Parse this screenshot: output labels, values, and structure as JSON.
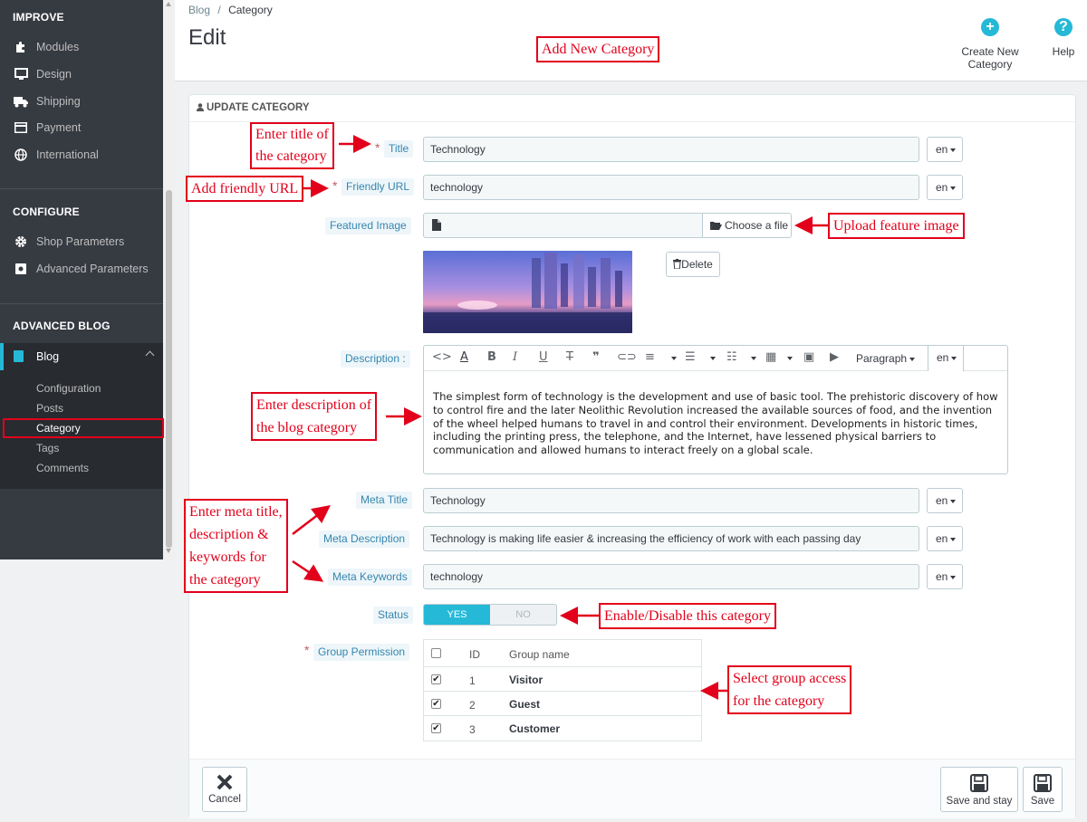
{
  "sidebar": {
    "sections": {
      "improve": "IMPROVE",
      "configure": "CONFIGURE",
      "advanced_blog": "ADVANCED BLOG"
    },
    "improve_items": [
      "Modules",
      "Design",
      "Shipping",
      "Payment",
      "International"
    ],
    "configure_items": [
      "Shop Parameters",
      "Advanced Parameters"
    ],
    "blog": "Blog",
    "blog_sub": [
      "Configuration",
      "Posts",
      "Category",
      "Tags",
      "Comments"
    ],
    "accent_color": "#25b9d7"
  },
  "header": {
    "breadcrumb": [
      "Blog",
      "/",
      "Category"
    ],
    "title": "Edit",
    "create_label": "Create New Category",
    "help_label": "Help"
  },
  "form": {
    "card_title": "UPDATE CATEGORY",
    "fields": {
      "title_label": "Title",
      "title_value": "Technology",
      "friendly_url_label": "Friendly URL",
      "friendly_url_value": "technology",
      "featured_image_label": "Featured Image",
      "choose_file": "Choose a file",
      "delete": "Delete",
      "description_label": "Description :",
      "description_text": "The simplest form of technology is the development and use of basic tool. The prehistoric discovery of how to control fire and the later Neolithic Revolution increased the available sources of food, and the invention of the wheel helped humans to travel in and control their environment. Developments in historic times, including the printing press, the telephone, and the Internet, have lessened physical barriers to communication and allowed humans to interact freely on a global scale.",
      "paragraph": "Paragraph",
      "meta_title_label": "Meta Title",
      "meta_title_value": "Technology",
      "meta_description_label": "Meta Description",
      "meta_description_value": "Technology is making life easier & increasing the efficiency of work with each passing day",
      "meta_keywords_label": "Meta Keywords",
      "meta_keywords_value": "technology",
      "status_label": "Status",
      "status_yes": "YES",
      "status_no": "NO",
      "group_permission_label": "Group Permission"
    },
    "lang": "en",
    "required_mark": "*",
    "group_table": {
      "headers": [
        "ID",
        "Group name"
      ],
      "rows": [
        {
          "id": "1",
          "name": "Visitor",
          "checked": true
        },
        {
          "id": "2",
          "name": "Guest",
          "checked": true
        },
        {
          "id": "3",
          "name": "Customer",
          "checked": true
        }
      ]
    },
    "footer": {
      "cancel": "Cancel",
      "save_and_stay": "Save and stay",
      "save": "Save"
    }
  },
  "annotations": {
    "add_new_category": "Add New Category",
    "enter_title": [
      "Enter title of",
      "the category"
    ],
    "friendly_url": "Add friendly URL",
    "upload_image": "Upload feature image",
    "enter_description": [
      "Enter description of",
      "the blog category"
    ],
    "meta": [
      "Enter meta title,",
      "description &",
      "keywords for",
      "the category"
    ],
    "enable_disable": "Enable/Disable this category",
    "group_access": [
      "Select group access",
      "for the category"
    ],
    "color": "#e2001a"
  }
}
